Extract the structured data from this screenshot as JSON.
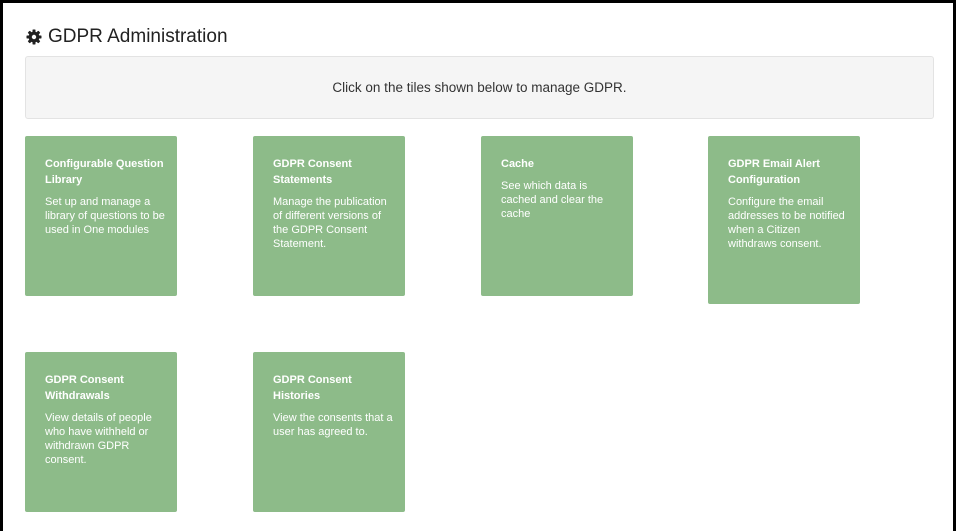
{
  "header": {
    "title": "GDPR Administration",
    "icon": "gear-icon"
  },
  "banner": {
    "text": "Click on the tiles shown below to manage GDPR."
  },
  "tiles": [
    {
      "title": "Configurable Question Library",
      "description": "Set up and manage a library of questions to be used in One modules"
    },
    {
      "title": "GDPR Consent Statements",
      "description": "Manage the publication of different versions of the GDPR Consent Statement."
    },
    {
      "title": "Cache",
      "description": "See which data is cached and clear the cache"
    },
    {
      "title": "GDPR Email Alert Configuration",
      "description": "Configure the email addresses to be notified when a Citizen withdraws consent."
    },
    {
      "title": "GDPR Consent Withdrawals",
      "description": "View details of people who have withheld or withdrawn GDPR consent."
    },
    {
      "title": "GDPR Consent Histories",
      "description": "View the consents that a user has agreed to."
    }
  ],
  "colors": {
    "tile_background": "#8dbb89",
    "tile_text": "#ffffff",
    "banner_background": "#f5f5f5"
  }
}
